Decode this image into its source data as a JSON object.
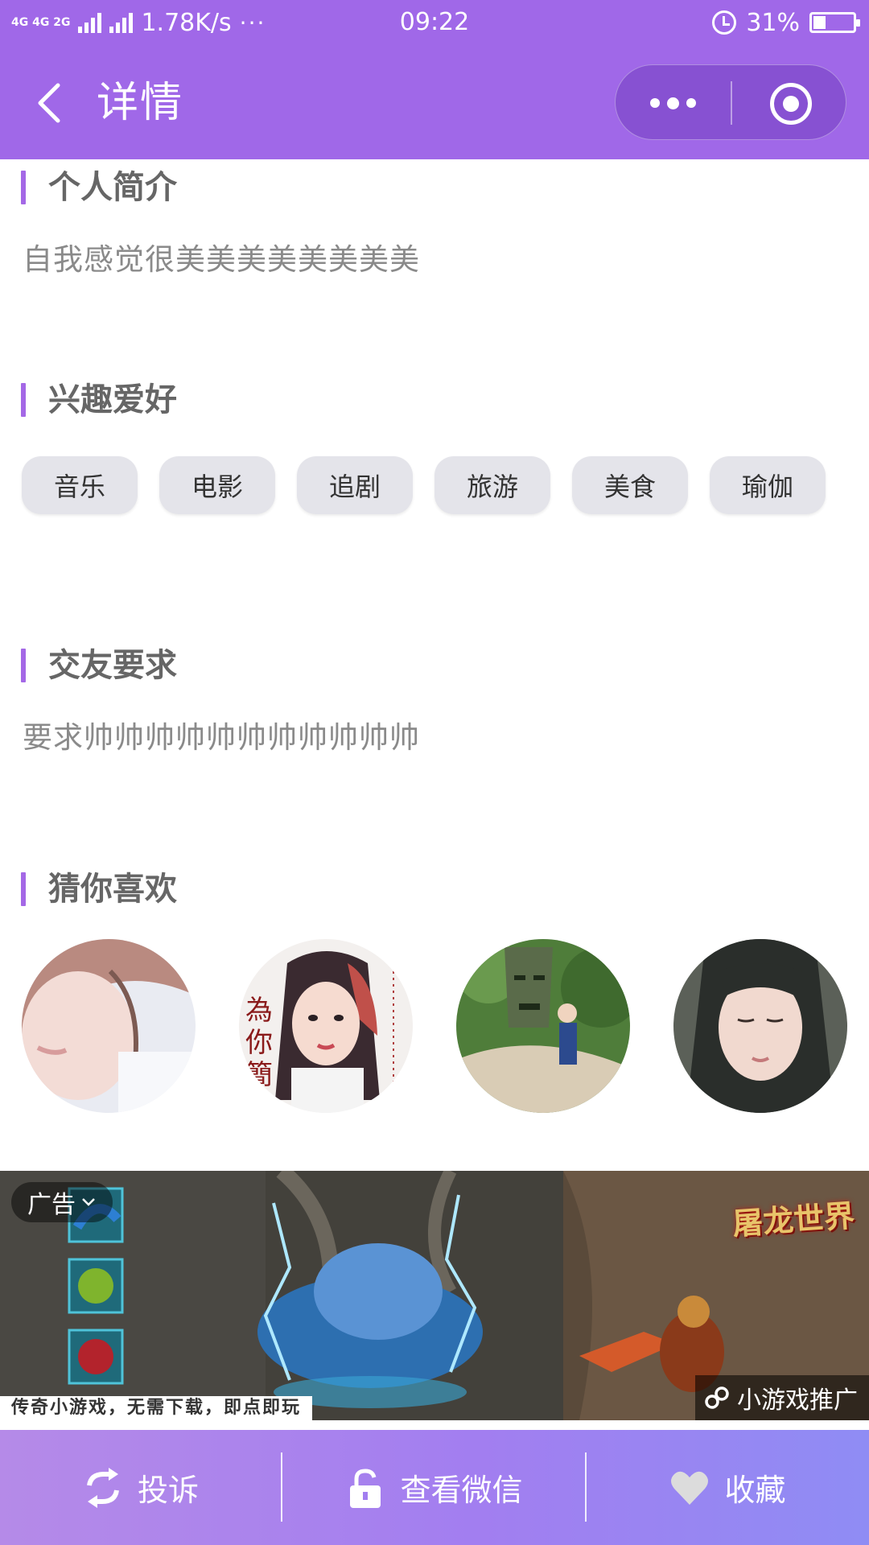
{
  "status_bar": {
    "network_labels": "4G 4G 2G",
    "speed": "1.78K/s",
    "more": "···",
    "time": "09:22",
    "battery_percent": "31%",
    "battery_level": 0.31
  },
  "navbar": {
    "title": "详情",
    "back_icon": "chevron-left-icon",
    "menu_icon": "more-dots-icon",
    "close_icon": "target-circle-icon"
  },
  "sections": {
    "intro": {
      "title": "个人简介",
      "text": "自我感觉很美美美美美美美美"
    },
    "hobbies": {
      "title": "兴趣爱好",
      "tags": [
        "音乐",
        "电影",
        "追剧",
        "旅游",
        "美食",
        "瑜伽"
      ]
    },
    "requirements": {
      "title": "交友要求",
      "text": "要求帅帅帅帅帅帅帅帅帅帅帅"
    },
    "recommend": {
      "title": "猜你喜欢",
      "avatars": [
        "avatar-1",
        "avatar-2",
        "avatar-3",
        "avatar-4"
      ]
    }
  },
  "ad": {
    "label": "广告",
    "caption": "传奇小游戏，无需下载，即点即玩",
    "promo": "小游戏推广",
    "logo": "屠龙世界"
  },
  "bottom_bar": {
    "complain": "投诉",
    "view_wechat": "查看微信",
    "favorite": "收藏"
  },
  "colors": {
    "theme": "#a068e8",
    "accent_bar": "#a468e6",
    "tag_bg": "#e4e4ea"
  }
}
